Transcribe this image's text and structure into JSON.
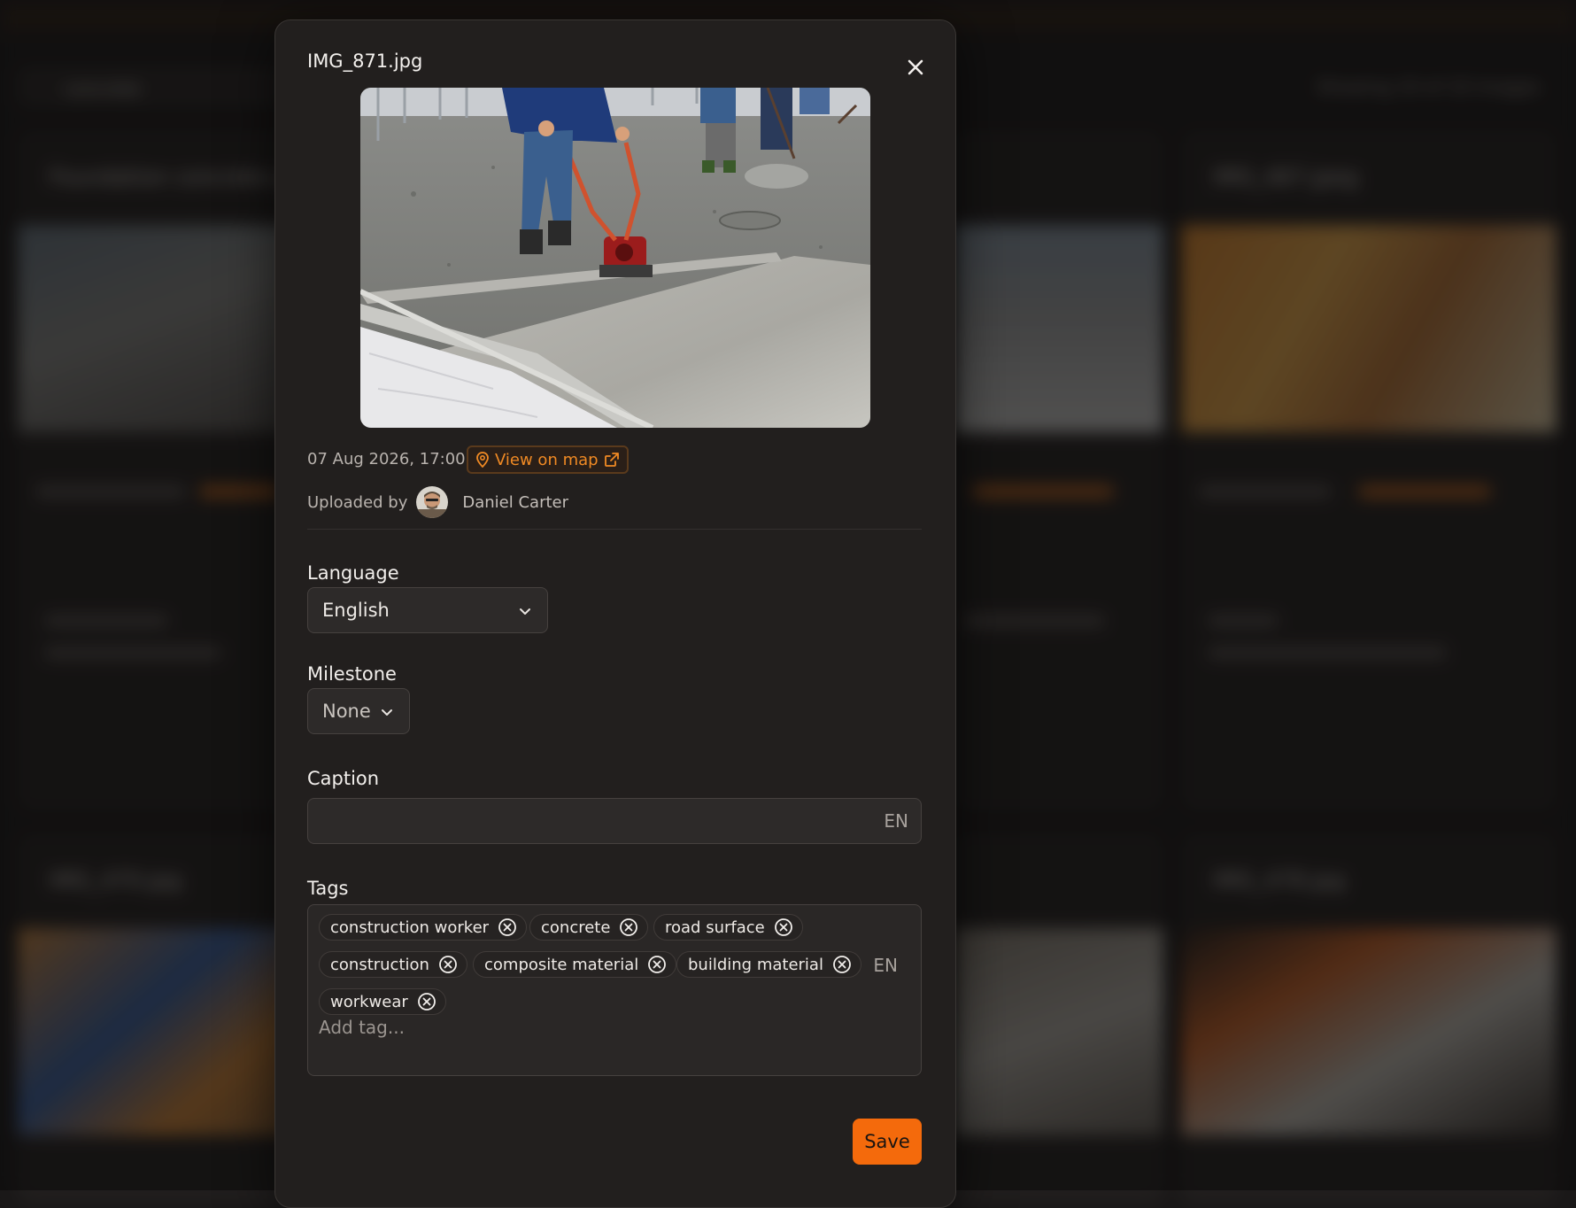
{
  "background": {
    "search_value": "concrete",
    "result_count": "Showing 10 of 10 images",
    "cards": [
      {
        "title": "Foundation concrete p"
      },
      {
        "title": ""
      },
      {
        "title": "IMG_467.jpeg"
      },
      {
        "title": "IMG_470.jpg"
      },
      {
        "title": ""
      },
      {
        "title": "IMG_478.jpg"
      }
    ]
  },
  "modal": {
    "title": "IMG_871.jpg",
    "close_icon": "close-icon",
    "date": "07 Aug 2026, 17:00",
    "map_link_label": "View on map",
    "uploaded_by_label": "Uploaded by",
    "uploader_name": "Daniel Carter",
    "language": {
      "label": "Language",
      "value": "English"
    },
    "milestone": {
      "label": "Milestone",
      "value": "None"
    },
    "caption": {
      "label": "Caption",
      "value": "",
      "lang": "EN"
    },
    "tags": {
      "label": "Tags",
      "items": [
        "construction worker",
        "concrete",
        "road surface",
        "construction",
        "composite material",
        "building material",
        "workwear"
      ],
      "lang": "EN",
      "placeholder": "Add tag..."
    },
    "save_label": "Save",
    "colors": {
      "accent": "#f46a0c",
      "link": "#f08a24",
      "surface": "#221f1e"
    }
  }
}
